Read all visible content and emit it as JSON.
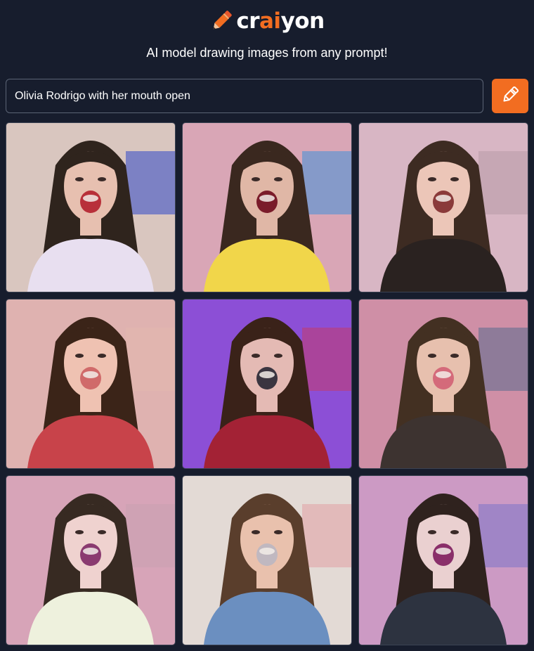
{
  "header": {
    "logo_prefix": "cr",
    "logo_accent": "ai",
    "logo_suffix": "yon",
    "tagline": "AI model drawing images from any prompt!"
  },
  "prompt": {
    "value": "Olivia Rodrigo with her mouth open"
  },
  "draw_button": {
    "icon": "pencil-icon"
  },
  "colors": {
    "background": "#171d2d",
    "accent": "#f26d21",
    "border": "#5b6475"
  },
  "results": {
    "count": 9,
    "tiles": [
      {
        "bg": "#d9c6bf",
        "hair": "#2f241d",
        "skin": "#e7c0b0",
        "shirt": "#e8dff0",
        "accent": "#2f49c9",
        "mouth": "#b8303a"
      },
      {
        "bg": "#d9a6b6",
        "hair": "#3a281f",
        "skin": "#e0b7a6",
        "shirt": "#f1d64a",
        "accent": "#3f8fd9",
        "mouth": "#7a1c2a"
      },
      {
        "bg": "#d8b6c4",
        "hair": "#3d2b22",
        "skin": "#ecc6b8",
        "shirt": "#2a2220",
        "accent": "#b89aa8",
        "mouth": "#8a3a3a"
      },
      {
        "bg": "#dfb2b0",
        "hair": "#3b2418",
        "skin": "#efc2b2",
        "shirt": "#c8434a",
        "accent": "#e2b8ae",
        "mouth": "#d06a6a"
      },
      {
        "bg": "#8c4fd6",
        "hair": "#3a2219",
        "skin": "#e4bab4",
        "shirt": "#a32235",
        "accent": "#c23d6c",
        "mouth": "#3a3540"
      },
      {
        "bg": "#cf8fa6",
        "hair": "#433022",
        "skin": "#e7c0ae",
        "shirt": "#3d3330",
        "accent": "#5a6b8e",
        "mouth": "#d46a7a"
      },
      {
        "bg": "#d7a4b8",
        "hair": "#372a22",
        "skin": "#efd2cf",
        "shirt": "#eef1dd",
        "accent": "#c8a0b0",
        "mouth": "#8a3a70"
      },
      {
        "bg": "#e3dad5",
        "hair": "#5a3e2c",
        "skin": "#e9c1ad",
        "shirt": "#6b8fc0",
        "accent": "#e2a0a4",
        "mouth": "#c0b8c0"
      },
      {
        "bg": "#cc9ac4",
        "hair": "#2f221e",
        "skin": "#ead0d0",
        "shirt": "#2d3340",
        "accent": "#7c74c8",
        "mouth": "#8a2f6a"
      }
    ]
  }
}
